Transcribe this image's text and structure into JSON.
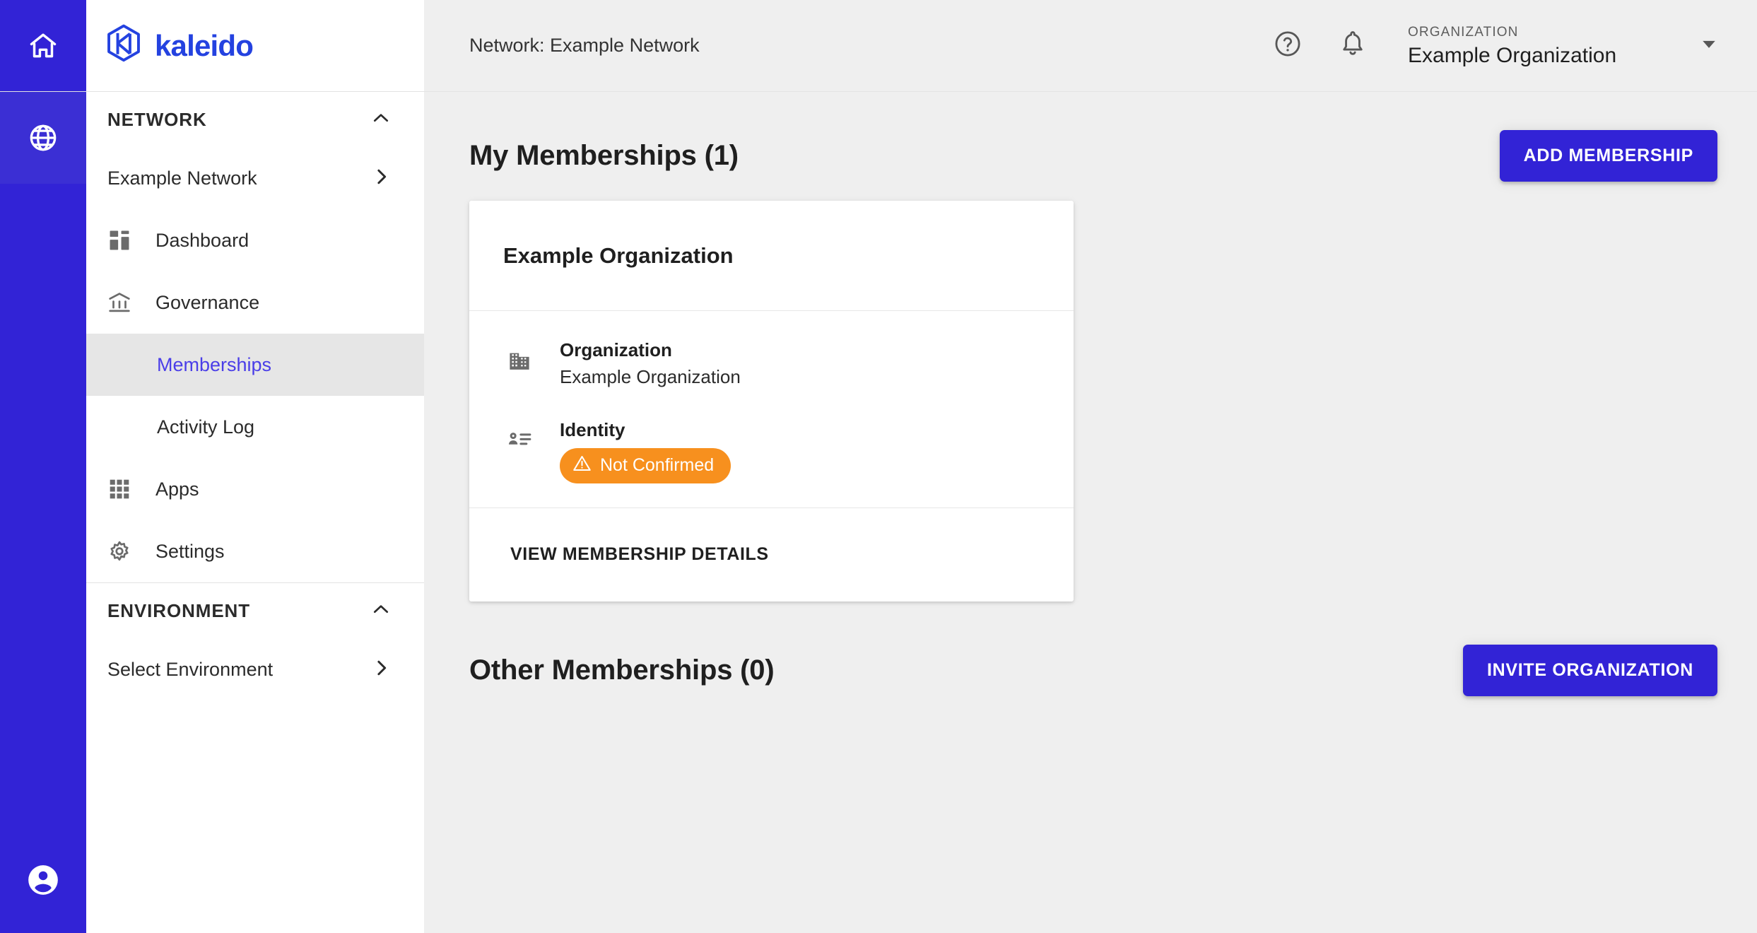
{
  "rail": {
    "items": [
      {
        "name": "home",
        "icon": "home-icon",
        "active": false
      },
      {
        "name": "network",
        "icon": "globe-icon",
        "active": true
      }
    ],
    "account": {
      "icon": "account-circle-icon"
    }
  },
  "brand": {
    "word": "kaleido",
    "logo_icon": "kaleido-logo-icon",
    "color": "#2442e0"
  },
  "sidebar": {
    "sections": [
      {
        "label": "NETWORK",
        "collapse_icon": "chevron-up-icon",
        "items": [
          {
            "label": "Example Network",
            "icon": null,
            "trailing": "chevron-right-icon",
            "active": false,
            "sub": false
          },
          {
            "label": "Dashboard",
            "icon": "dashboard-icon",
            "trailing": null,
            "active": false,
            "sub": false
          },
          {
            "label": "Governance",
            "icon": "governance-icon",
            "trailing": null,
            "active": false,
            "sub": false
          },
          {
            "label": "Memberships",
            "icon": null,
            "trailing": null,
            "active": true,
            "sub": true
          },
          {
            "label": "Activity Log",
            "icon": null,
            "trailing": null,
            "active": false,
            "sub": true
          },
          {
            "label": "Apps",
            "icon": "apps-grid-icon",
            "trailing": null,
            "active": false,
            "sub": false
          },
          {
            "label": "Settings",
            "icon": "gear-icon",
            "trailing": null,
            "active": false,
            "sub": false
          }
        ]
      },
      {
        "label": "ENVIRONMENT",
        "collapse_icon": "chevron-up-icon",
        "items": [
          {
            "label": "Select Environment",
            "icon": null,
            "trailing": "chevron-right-icon",
            "active": false,
            "sub": false
          }
        ]
      }
    ]
  },
  "topbar": {
    "breadcrumb": "Network: Example Network",
    "help_icon": "help-circle-icon",
    "notifications_icon": "bell-icon",
    "org_label": "ORGANIZATION",
    "org_name": "Example Organization",
    "org_caret_icon": "caret-down-icon"
  },
  "main": {
    "my_memberships_title": "My Memberships (1)",
    "add_membership_label": "ADD MEMBERSHIP",
    "other_memberships_title": "Other Memberships (0)",
    "invite_organization_label": "INVITE ORGANIZATION",
    "card": {
      "title": "Example Organization",
      "rows": [
        {
          "icon": "building-icon",
          "label": "Organization",
          "value": "Example Organization",
          "badge": null
        },
        {
          "icon": "contact-badge-icon",
          "label": "Identity",
          "value": null,
          "badge": {
            "text": "Not Confirmed",
            "icon": "warning-triangle-icon",
            "color": "#f7901e"
          }
        }
      ],
      "footer_link": "VIEW MEMBERSHIP DETAILS"
    }
  },
  "colors": {
    "brand_blue": "#3223d6",
    "rail_active": "#3b2fd4",
    "page_bg": "#efefef",
    "warning_orange": "#f7901e",
    "active_nav_text": "#4a3ee8"
  }
}
